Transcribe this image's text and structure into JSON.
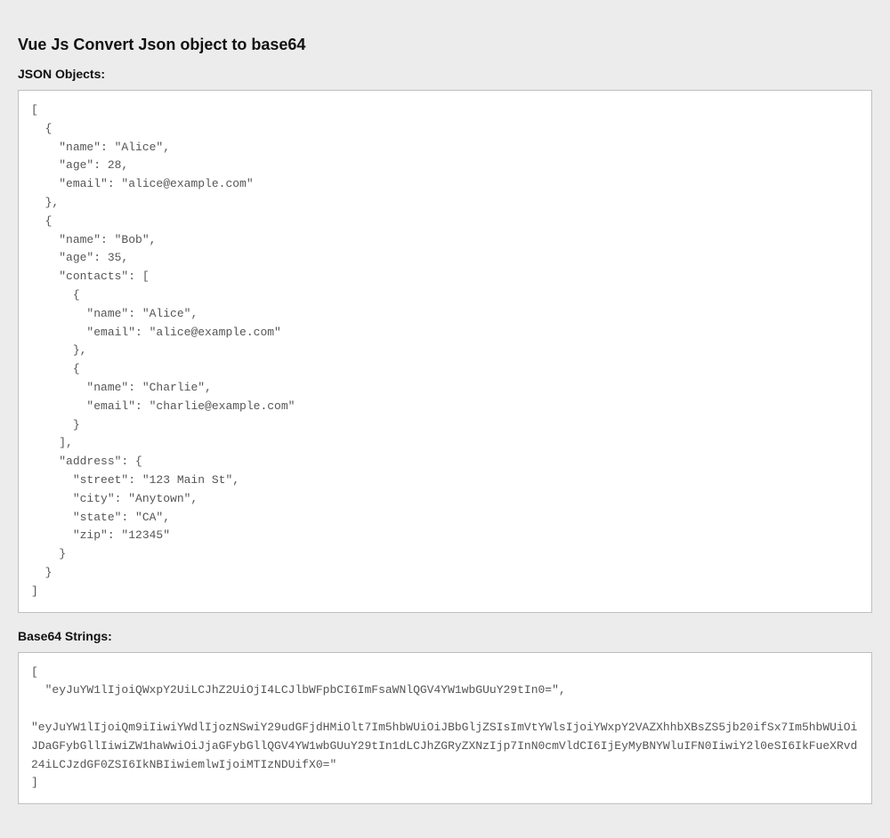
{
  "title": "Vue Js Convert Json object to base64",
  "sections": {
    "json_label": "JSON Objects:",
    "base64_label": "Base64 Strings:"
  },
  "json_block": "[\n  {\n    \"name\": \"Alice\",\n    \"age\": 28,\n    \"email\": \"alice@example.com\"\n  },\n  {\n    \"name\": \"Bob\",\n    \"age\": 35,\n    \"contacts\": [\n      {\n        \"name\": \"Alice\",\n        \"email\": \"alice@example.com\"\n      },\n      {\n        \"name\": \"Charlie\",\n        \"email\": \"charlie@example.com\"\n      }\n    ],\n    \"address\": {\n      \"street\": \"123 Main St\",\n      \"city\": \"Anytown\",\n      \"state\": \"CA\",\n      \"zip\": \"12345\"\n    }\n  }\n]",
  "base64_block": "[\n  \"eyJuYW1lIjoiQWxpY2UiLCJhZ2UiOjI4LCJlbWFpbCI6ImFsaWNlQGV4YW1wbGUuY29tIn0=\",\n\n\"eyJuYW1lIjoiQm9iIiwiYWdlIjozNSwiY29udGFjdHMiOlt7Im5hbWUiOiJBbGljZSIsImVtYWlsIjoiYWxpY2VAZXhhbXBsZS5jb20ifSx7Im5hbWUiOiJDaGFybGllIiwiZW1haWwiOiJjaGFybGllQGV4YW1wbGUuY29tIn1dLCJhZGRyZXNzIjp7InN0cmVldCI6IjEyMyBNYWluIFN0IiwiY2l0eSI6IkFueXRvd24iLCJzdGF0ZSI6IkNBIiwiemlwIjoiMTIzNDUifX0=\"\n]"
}
